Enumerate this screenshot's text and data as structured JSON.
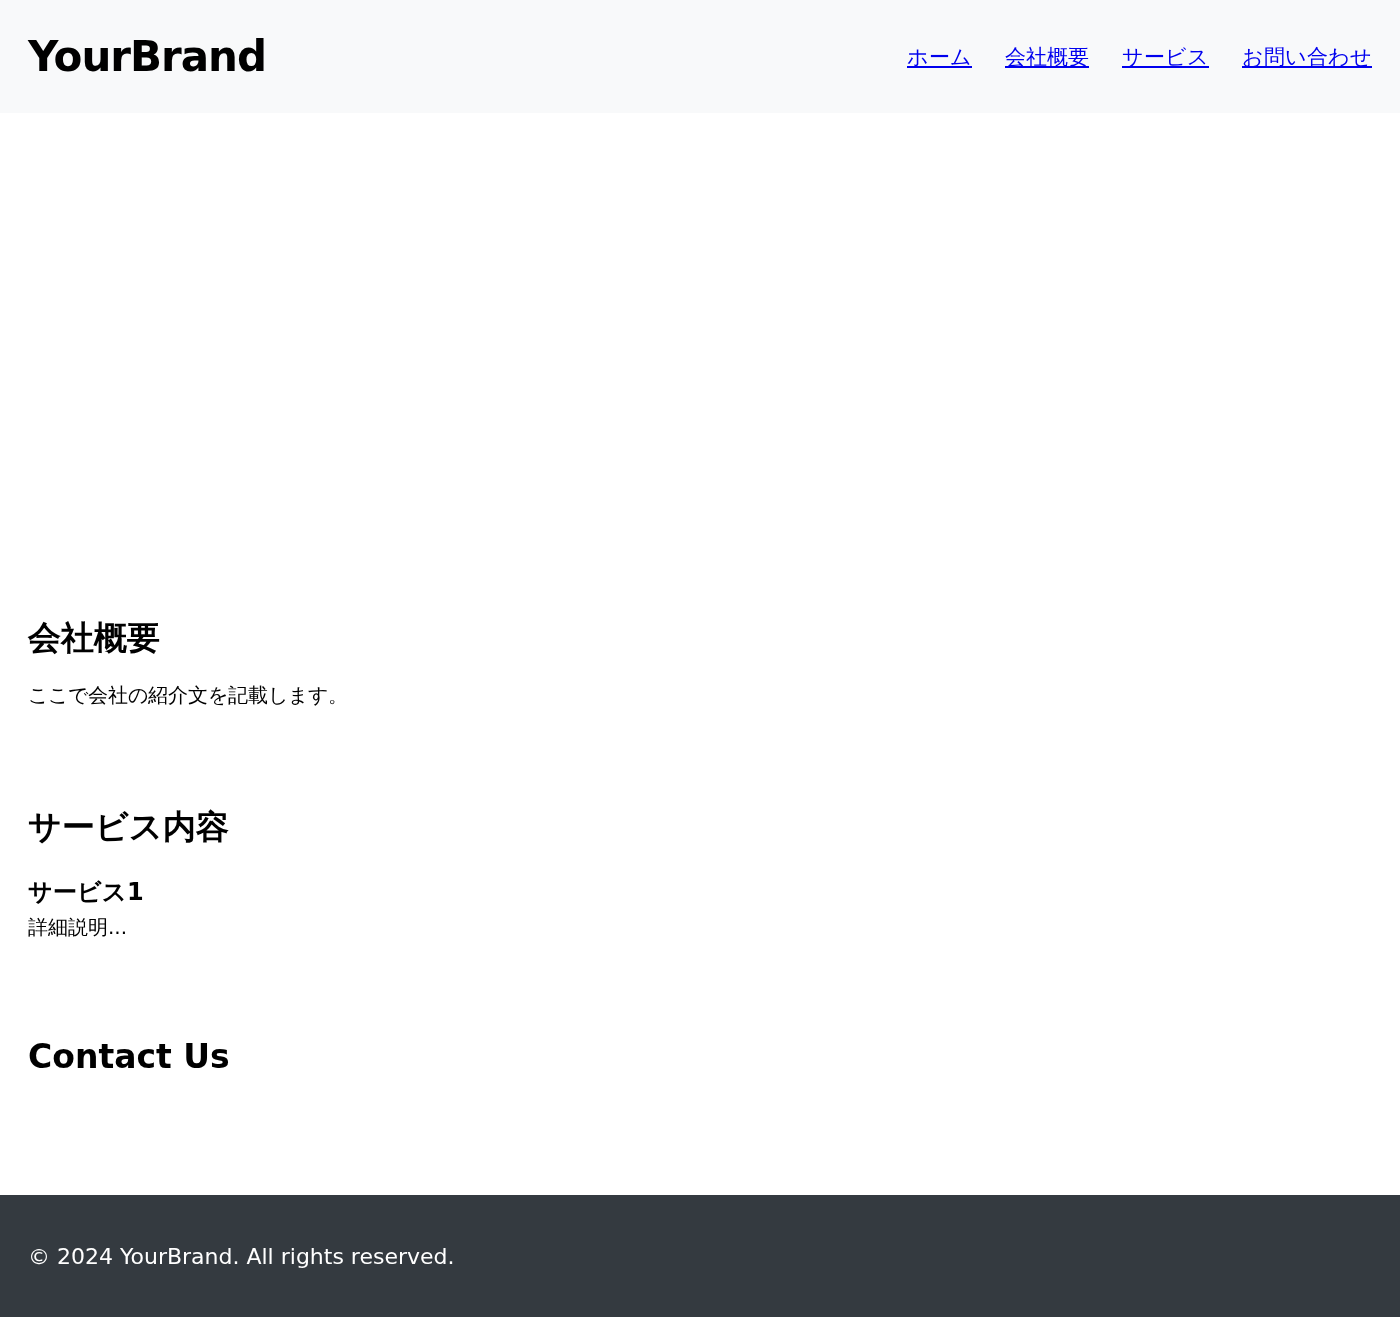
{
  "header": {
    "brand": "YourBrand",
    "nav": [
      {
        "label": "ホーム"
      },
      {
        "label": "会社概要"
      },
      {
        "label": "サービス"
      },
      {
        "label": "お問い合わせ"
      }
    ]
  },
  "about": {
    "title": "会社概要",
    "text": "ここで会社の紹介文を記載します。"
  },
  "services": {
    "title": "サービス内容",
    "items": [
      {
        "name": "サービス1",
        "description": "詳細説明..."
      }
    ]
  },
  "contact": {
    "title": "Contact Us"
  },
  "footer": {
    "text": "© 2024 YourBrand. All rights reserved."
  }
}
